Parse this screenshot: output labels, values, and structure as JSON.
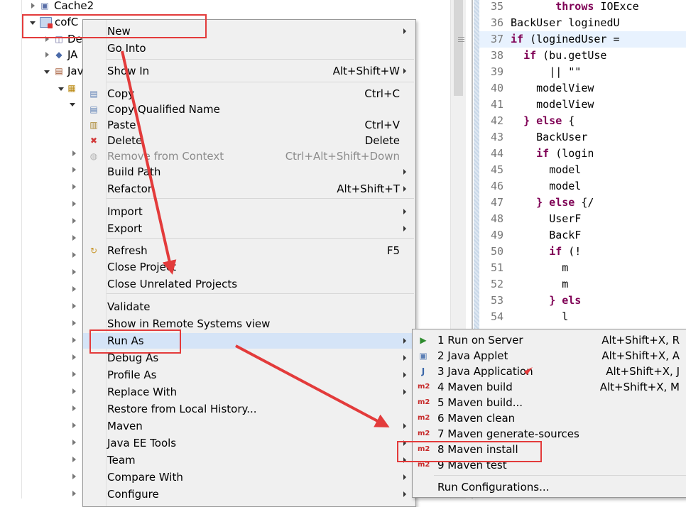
{
  "explorer": {
    "items": [
      {
        "label": "Cache2",
        "expander": "closed"
      },
      {
        "label": "cofC",
        "expander": "open"
      },
      {
        "label": "De",
        "expander": "closed"
      },
      {
        "label": "JA",
        "expander": "closed"
      },
      {
        "label": "Jav",
        "expander": "open"
      }
    ]
  },
  "editor": {
    "lines": [
      {
        "n": "35",
        "kw": "throws",
        "text": " IOExce"
      },
      {
        "n": "36",
        "kw": "",
        "text": "BackUser loginedU"
      },
      {
        "n": "37",
        "kw": "if",
        "text": " (loginedUser ="
      },
      {
        "n": "38",
        "kw": "if",
        "text": " (bu.getUse"
      },
      {
        "n": "39",
        "kw": "",
        "text": "|| \"\""
      },
      {
        "n": "40",
        "kw": "",
        "text": "modelView"
      },
      {
        "n": "41",
        "kw": "",
        "text": "modelView"
      },
      {
        "n": "42",
        "kw": "} else",
        "text": " {"
      },
      {
        "n": "43",
        "kw": "",
        "text": "BackUser"
      },
      {
        "n": "44",
        "kw": "if",
        "text": " (login"
      },
      {
        "n": "45",
        "kw": "",
        "text": "model"
      },
      {
        "n": "46",
        "kw": "",
        "text": "model"
      },
      {
        "n": "47",
        "kw": "} else",
        "text": " {/"
      },
      {
        "n": "48",
        "kw": "",
        "text": "UserF"
      },
      {
        "n": "49",
        "kw": "",
        "text": "BackF"
      },
      {
        "n": "50",
        "kw": "if",
        "text": " (!"
      },
      {
        "n": "51",
        "kw": "",
        "text": "m"
      },
      {
        "n": "52",
        "kw": "",
        "text": "m"
      },
      {
        "n": "53",
        "kw": "} els",
        "text": ""
      },
      {
        "n": "54",
        "kw": "",
        "text": "l"
      }
    ]
  },
  "context_menu": {
    "items": [
      {
        "label": "New",
        "shortcut": "",
        "submenu": true
      },
      {
        "label": "Go Into",
        "shortcut": ""
      },
      {
        "label": "Show In",
        "shortcut": "Alt+Shift+W",
        "submenu": true
      },
      {
        "label": "Copy",
        "shortcut": "Ctrl+C",
        "icon": "copy-icon"
      },
      {
        "label": "Copy Qualified Name",
        "shortcut": "",
        "icon": "copy-qualified-icon"
      },
      {
        "label": "Paste",
        "shortcut": "Ctrl+V",
        "icon": "paste-icon"
      },
      {
        "label": "Delete",
        "shortcut": "Delete",
        "icon": "delete-icon"
      },
      {
        "label": "Remove from Context",
        "shortcut": "Ctrl+Alt+Shift+Down",
        "disabled": true,
        "icon": "remove-context-icon"
      },
      {
        "label": "Build Path",
        "shortcut": "",
        "submenu": true
      },
      {
        "label": "Refactor",
        "shortcut": "Alt+Shift+T",
        "submenu": true
      },
      {
        "label": "Import",
        "shortcut": "",
        "submenu": true
      },
      {
        "label": "Export",
        "shortcut": "",
        "submenu": true
      },
      {
        "label": "Refresh",
        "shortcut": "F5",
        "icon": "refresh-icon"
      },
      {
        "label": "Close Project",
        "shortcut": ""
      },
      {
        "label": "Close Unrelated Projects",
        "shortcut": ""
      },
      {
        "label": "Validate",
        "shortcut": ""
      },
      {
        "label": "Show in Remote Systems view",
        "shortcut": ""
      },
      {
        "label": "Run As",
        "shortcut": "",
        "submenu": true
      },
      {
        "label": "Debug As",
        "shortcut": "",
        "submenu": true
      },
      {
        "label": "Profile As",
        "shortcut": "",
        "submenu": true
      },
      {
        "label": "Replace With",
        "shortcut": "",
        "submenu": true
      },
      {
        "label": "Restore from Local History...",
        "shortcut": ""
      },
      {
        "label": "Maven",
        "shortcut": "",
        "submenu": true
      },
      {
        "label": "Java EE Tools",
        "shortcut": "",
        "submenu": true
      },
      {
        "label": "Team",
        "shortcut": "",
        "submenu": true
      },
      {
        "label": "Compare With",
        "shortcut": "",
        "submenu": true
      },
      {
        "label": "Configure",
        "shortcut": "",
        "submenu": true
      }
    ]
  },
  "run_as_menu": {
    "items": [
      {
        "label": "1 Run on Server",
        "shortcut": "Alt+Shift+X, R",
        "icon": "server-icon"
      },
      {
        "label": "2 Java Applet",
        "shortcut": "Alt+Shift+X, A",
        "icon": "applet-icon"
      },
      {
        "label": "3 Java Application",
        "shortcut": "Alt+Shift+X, J",
        "icon": "java-app-icon"
      },
      {
        "label": "4 Maven build",
        "shortcut": "Alt+Shift+X, M",
        "icon": "m2"
      },
      {
        "label": "5 Maven build...",
        "shortcut": "",
        "icon": "m2"
      },
      {
        "label": "6 Maven clean",
        "shortcut": "",
        "icon": "m2"
      },
      {
        "label": "7 Maven generate-sources",
        "shortcut": "",
        "icon": "m2"
      },
      {
        "label": "8 Maven install",
        "shortcut": "",
        "icon": "m2"
      },
      {
        "label": "9 Maven test",
        "shortcut": "",
        "icon": "m2"
      },
      {
        "label": "Run Configurations...",
        "shortcut": ""
      }
    ],
    "maven_badge": "m2"
  },
  "colors": {
    "annotation": "#e33b3b",
    "keyword": "#7f0055",
    "menu_bg": "#f0f0f0",
    "highlight": "#d5e4f7"
  }
}
